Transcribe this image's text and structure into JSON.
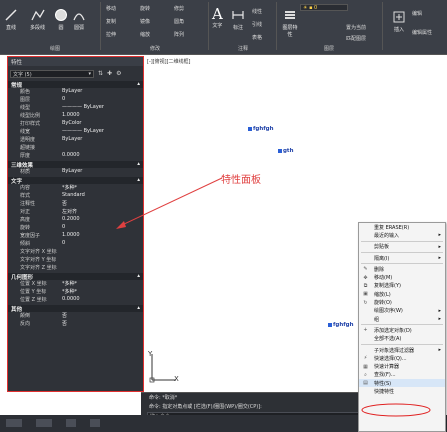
{
  "ribbon": {
    "groups": [
      "绘图",
      "修改",
      "注释",
      "图层"
    ],
    "draw_tools": [
      "直线",
      "多段线",
      "圆",
      "圆弧"
    ],
    "modify_tools": [
      "移动",
      "旋转",
      "修剪",
      "复制",
      "镜像",
      "圆角",
      "拉伸",
      "缩放",
      "阵列"
    ],
    "annot_tools": [
      "文字",
      "标注",
      "线性",
      "引线",
      "表格"
    ],
    "layer_tools": [
      "图层特性",
      "置为当前",
      "匹配图层"
    ],
    "right_tools": [
      "插入",
      "编辑",
      "编辑属性"
    ],
    "accent_color": "#3b3f47"
  },
  "canvas": {
    "title": "[-][俯视][二维线框]",
    "entities": [
      "fghfgh",
      "gth",
      "fghfgh"
    ],
    "annotation": "特性面板",
    "annotation_color": "#e04040",
    "ucs_y": "Y",
    "ucs_x": "X"
  },
  "properties": {
    "title": "特性",
    "selection": "文字 (5)",
    "sections": [
      {
        "name": "常规",
        "rows": [
          [
            "颜色",
            "ByLayer"
          ],
          [
            "图层",
            "0"
          ],
          [
            "线型",
            "———— ByLayer"
          ],
          [
            "线型比例",
            "1.0000"
          ],
          [
            "打印样式",
            "ByColor"
          ],
          [
            "线宽",
            "———— ByLayer"
          ],
          [
            "透明度",
            "ByLayer"
          ],
          [
            "超链接",
            ""
          ],
          [
            "厚度",
            "0.0000"
          ]
        ]
      },
      {
        "name": "三维效果",
        "rows": [
          [
            "材质",
            "ByLayer"
          ]
        ]
      },
      {
        "name": "文字",
        "rows": [
          [
            "内容",
            "*多种*"
          ],
          [
            "样式",
            "Standard"
          ],
          [
            "注释性",
            "否"
          ],
          [
            "对正",
            "左对齐"
          ],
          [
            "高度",
            "0.2000"
          ],
          [
            "旋转",
            "0"
          ],
          [
            "宽度因子",
            "1.0000"
          ],
          [
            "倾斜",
            "0"
          ],
          [
            "文字对齐 X 坐标",
            ""
          ],
          [
            "文字对齐 Y 坐标",
            ""
          ],
          [
            "文字对齐 Z 坐标",
            ""
          ]
        ]
      },
      {
        "name": "几何图形",
        "rows": [
          [
            "位置 X 坐标",
            "*多种*"
          ],
          [
            "位置 Y 坐标",
            "*多种*"
          ],
          [
            "位置 Z 坐标",
            "0.0000"
          ]
        ]
      },
      {
        "name": "其他",
        "rows": [
          [
            "颠倒",
            "否"
          ],
          [
            "反向",
            "否"
          ]
        ]
      }
    ]
  },
  "command": {
    "line1": "命令: *取消*",
    "line2": "命令: 指定对角点或 [栏选(F)/圈围(WP)/圈交(CP)]:",
    "input_placeholder": "键入命令"
  },
  "context_menu": {
    "items": [
      {
        "label": "重复 ERASE(R)",
        "sub": false,
        "icon": ""
      },
      {
        "label": "最近的输入",
        "sub": true,
        "icon": ""
      },
      {
        "sep": true
      },
      {
        "label": "剪贴板",
        "sub": true,
        "icon": ""
      },
      {
        "sep": true
      },
      {
        "label": "隔离(I)",
        "sub": true,
        "icon": ""
      },
      {
        "sep": true
      },
      {
        "label": "删除",
        "sub": false,
        "icon": "✎"
      },
      {
        "label": "移动(M)",
        "sub": false,
        "icon": "✥"
      },
      {
        "label": "复制选择(Y)",
        "sub": false,
        "icon": "⧉"
      },
      {
        "label": "缩放(L)",
        "sub": false,
        "icon": "▣"
      },
      {
        "label": "旋转(O)",
        "sub": false,
        "icon": "↻"
      },
      {
        "label": "绘图次序(W)",
        "sub": true,
        "icon": ""
      },
      {
        "label": "组",
        "sub": true,
        "icon": ""
      },
      {
        "sep": true
      },
      {
        "label": "添加选定对象(D)",
        "sub": false,
        "icon": "+"
      },
      {
        "label": "全部不选(A)",
        "sub": false,
        "icon": ""
      },
      {
        "sep": true
      },
      {
        "label": "子对象选择过滤器",
        "sub": true,
        "icon": ""
      },
      {
        "label": "快速选择(Q)...",
        "sub": false,
        "icon": "⚡"
      },
      {
        "label": "快速计算器",
        "sub": false,
        "icon": "▦"
      },
      {
        "label": "查找(F)...",
        "sub": false,
        "icon": "⌕"
      },
      {
        "label": "特性(S)",
        "sub": false,
        "icon": "▤",
        "highlight": true
      },
      {
        "label": "快捷特性",
        "sub": false,
        "icon": ""
      }
    ]
  }
}
